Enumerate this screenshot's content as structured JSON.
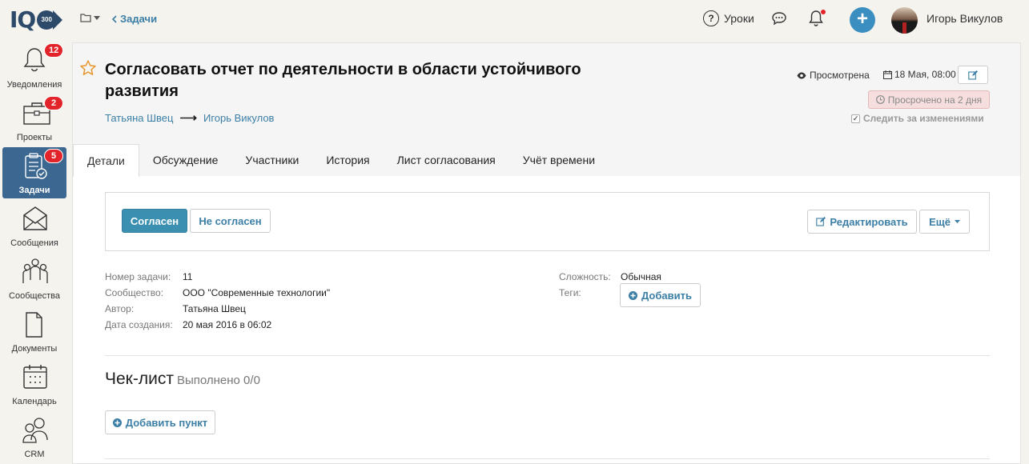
{
  "header": {
    "logo_text": "IQ",
    "logo_badge": "300",
    "back_link": "Задачи",
    "lessons_label": "Уроки",
    "user_name": "Игорь Викулов"
  },
  "sidebar": {
    "items": [
      {
        "label": "Уведомления",
        "badge": "12"
      },
      {
        "label": "Проекты",
        "badge": "2"
      },
      {
        "label": "Задачи",
        "badge": "5"
      },
      {
        "label": "Сообщения",
        "badge": ""
      },
      {
        "label": "Сообщества",
        "badge": ""
      },
      {
        "label": "Документы",
        "badge": ""
      },
      {
        "label": "Календарь",
        "badge": ""
      },
      {
        "label": "CRM",
        "badge": ""
      }
    ]
  },
  "task": {
    "title": "Согласовать отчет по деятельности в области устойчивого развития",
    "from": "Татьяна Швец",
    "to": "Игорь Викулов",
    "viewed": "Просмотрена",
    "date": "18 Мая, 08:00",
    "overdue": "Просрочено на 2 дня",
    "follow": "Следить за изменениями"
  },
  "tabs": [
    "Детали",
    "Обсуждение",
    "Участники",
    "История",
    "Лист согласования",
    "Учёт времени"
  ],
  "actions": {
    "agree": "Согласен",
    "disagree": "Не согласен",
    "edit": "Редактировать",
    "more": "Ещё"
  },
  "details": {
    "number_label": "Номер задачи:",
    "number": "11",
    "community_label": "Сообщество:",
    "community": "ООО \"Современные технологии\"",
    "author_label": "Автор:",
    "author": "Татьяна Швец",
    "created_label": "Дата создания:",
    "created": "20 мая 2016 в 06:02",
    "complexity_label": "Сложность:",
    "complexity": "Обычная",
    "tags_label": "Теги:",
    "add_tag": "Добавить"
  },
  "checklist": {
    "title": "Чек-лист",
    "status": "Выполнено 0/0",
    "add_item": "Добавить пункт"
  }
}
